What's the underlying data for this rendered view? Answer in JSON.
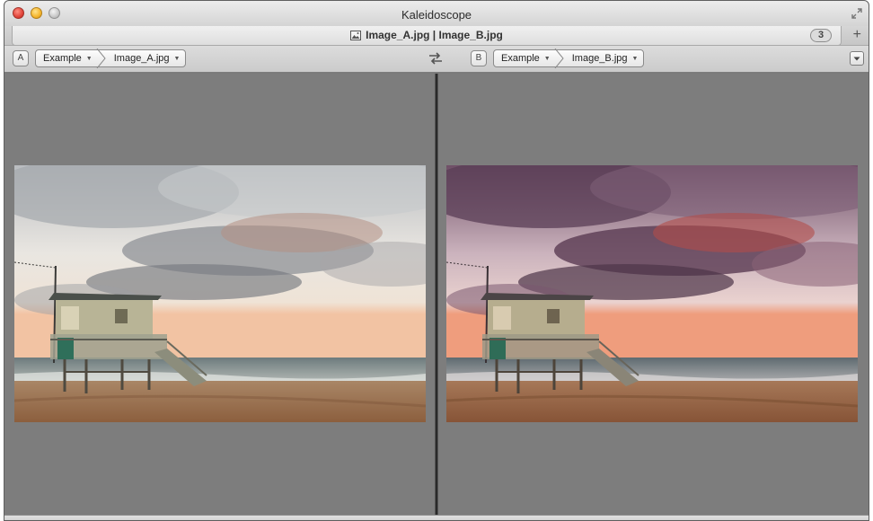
{
  "window": {
    "title": "Kaleidoscope"
  },
  "tab": {
    "title": "Image_A.jpg | Image_B.jpg",
    "badge": "3",
    "add_label": "+"
  },
  "toolbar": {
    "left": {
      "letter": "A",
      "crumbs": [
        "Example",
        "Image_A.jpg"
      ]
    },
    "right": {
      "letter": "B",
      "crumbs": [
        "Example",
        "Image_B.jpg"
      ]
    },
    "swap_icon": "swap-arrows-icon",
    "menu_icon": "dropdown-menu-icon"
  },
  "panes": {
    "left": {
      "image": "lifeguard-tower-original",
      "tint": "neutral"
    },
    "right": {
      "image": "lifeguard-tower-edited",
      "tint": "purple-red"
    }
  },
  "colors": {
    "sky_left": "#d9d8d4",
    "sky_right": "#8c6a82",
    "sand": "#a57a58",
    "divider": "#2a2a2a"
  }
}
